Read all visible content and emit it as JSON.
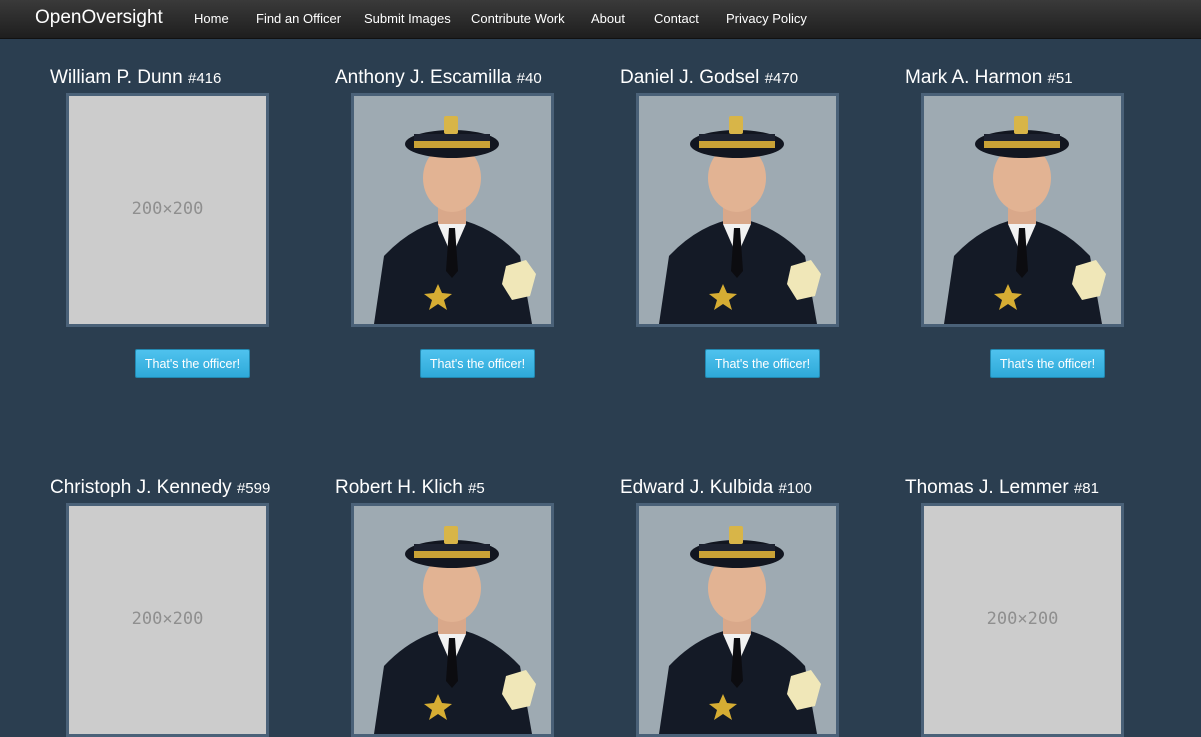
{
  "navbar": {
    "brand": "OpenOversight",
    "links": [
      "Home",
      "Find an Officer",
      "Submit Images",
      "Contribute Work",
      "About",
      "Contact",
      "Privacy Policy"
    ]
  },
  "colors": {
    "background": "#2b3e50",
    "button": "#3cb5e5",
    "placeholder": "#cccccc"
  },
  "officers": [
    {
      "name": "William P. Dunn",
      "badge": "#416",
      "photo": "placeholder",
      "placeholder_text": "200×200",
      "button": "That's the officer!"
    },
    {
      "name": "Anthony J. Escamilla",
      "badge": "#40",
      "photo": "portrait",
      "button": "That's the officer!"
    },
    {
      "name": "Daniel J. Godsel",
      "badge": "#470",
      "photo": "portrait",
      "button": "That's the officer!"
    },
    {
      "name": "Mark A. Harmon",
      "badge": "#51",
      "photo": "portrait",
      "button": "That's the officer!"
    },
    {
      "name": "Christoph J. Kennedy",
      "badge": "#599",
      "photo": "placeholder",
      "placeholder_text": "200×200"
    },
    {
      "name": "Robert H. Klich",
      "badge": "#5",
      "photo": "portrait"
    },
    {
      "name": "Edward J. Kulbida",
      "badge": "#100",
      "photo": "portrait"
    },
    {
      "name": "Thomas J. Lemmer",
      "badge": "#81",
      "photo": "placeholder",
      "placeholder_text": "200×200"
    }
  ]
}
